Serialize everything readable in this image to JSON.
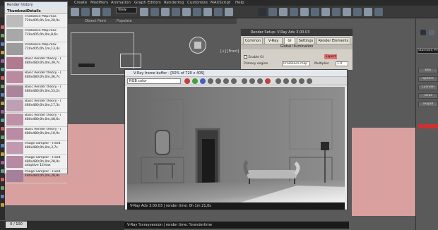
{
  "menubar": {
    "items": [
      "Create",
      "Modifiers",
      "Animation",
      "Graph Editors",
      "Rendering",
      "Customize",
      "MAXScript",
      "Help"
    ]
  },
  "toolbar": {
    "view_label": "View"
  },
  "viewport": {
    "labels": [
      "Object Paint",
      "Populate"
    ],
    "front_label": "[+] [Front] [Realistic]"
  },
  "history": {
    "title": "Render history",
    "col_thumbnail": "Thumbnail",
    "col_details": "Details",
    "rows": [
      {
        "line1": "Irradiance Map.max",
        "line2": "720x405;0h,1m,20,9s",
        "color": "#bcbcbc"
      },
      {
        "line1": "Irradiance Map.max",
        "line2": "720x405;0h,0m,8,6s",
        "color": "#a8a8a8"
      },
      {
        "line1": "Irradiance Map.max",
        "line2": "720x405;0h,1m,13,4s",
        "color": "#9c9c9c"
      },
      {
        "line1": "Basic Render theory - (",
        "line2": "480x480;0h,0m,39,7s",
        "color": "#b07a90"
      },
      {
        "line1": "Basic Render theory - (",
        "line2": "480x480;0h,0m,36,7s",
        "color": "#bb8aa0"
      },
      {
        "line1": "Basic Render theory - (",
        "line2": "480x480;0h,0m,53,2s",
        "color": "#a9849a"
      },
      {
        "line1": "Basic Render theory - (",
        "line2": "480x480;0h,0m,17,3s",
        "color": "#bda0b4"
      },
      {
        "line1": "Basic Render theory - (",
        "line2": "480x480;0h,0m,48,6s",
        "color": "#c090a8"
      },
      {
        "line1": "Basic Render theory - (",
        "line2": "480x480;0h,0m,10,9s",
        "color": "#b98ca4"
      },
      {
        "line1": "Image Sampler - Fixed.",
        "line2": "480x480;0h,0m,3,7s",
        "color": "#c29ab0"
      },
      {
        "line1": "Image Sampler - Fixed.",
        "line2": "480x480;0h,0m,28,9s",
        "color": "#b68aa2",
        "line3": "adaptive 12max"
      },
      {
        "line1": "Image Sampler - Fixed.",
        "line2": "480x480;0h,0m,28,9s",
        "color": "#a6809a"
      }
    ]
  },
  "setup": {
    "title": "Render Setup: V-Ray Adv 3.00.03",
    "tabs": [
      "Common",
      "V-Ray",
      "GI",
      "Settings",
      "Render Elements"
    ],
    "section": "Global illumination",
    "enable_gi": "Enable GI",
    "expert_label": "Expert",
    "primary_engine_label": "Primary engine",
    "primary_engine_value": "Irradiance map",
    "multiplier_label": "Multiplier",
    "multiplier_value": "1.0"
  },
  "vfb": {
    "title": "V-Ray frame buffer - [50% of 720 x 405]",
    "channel": "RGB color",
    "status": "V-Ray Adv 3.00.03 | render time: 0h 1m 21,0s"
  },
  "bottom_bar": {
    "frame_label": "0 / 100",
    "vfb_stamp": "V-Ray %vrayversion | render time: %rendertime"
  },
  "command_panel": {
    "combo": "Standard Primitives",
    "buttons": [
      "Box",
      "Sphere",
      "Cylinder",
      "Torus",
      "Teapot"
    ]
  },
  "colors": {
    "accent_pink": "#d9a0a0",
    "vfb_bg": "#e8e8e8",
    "expert_red": "#e07070"
  }
}
